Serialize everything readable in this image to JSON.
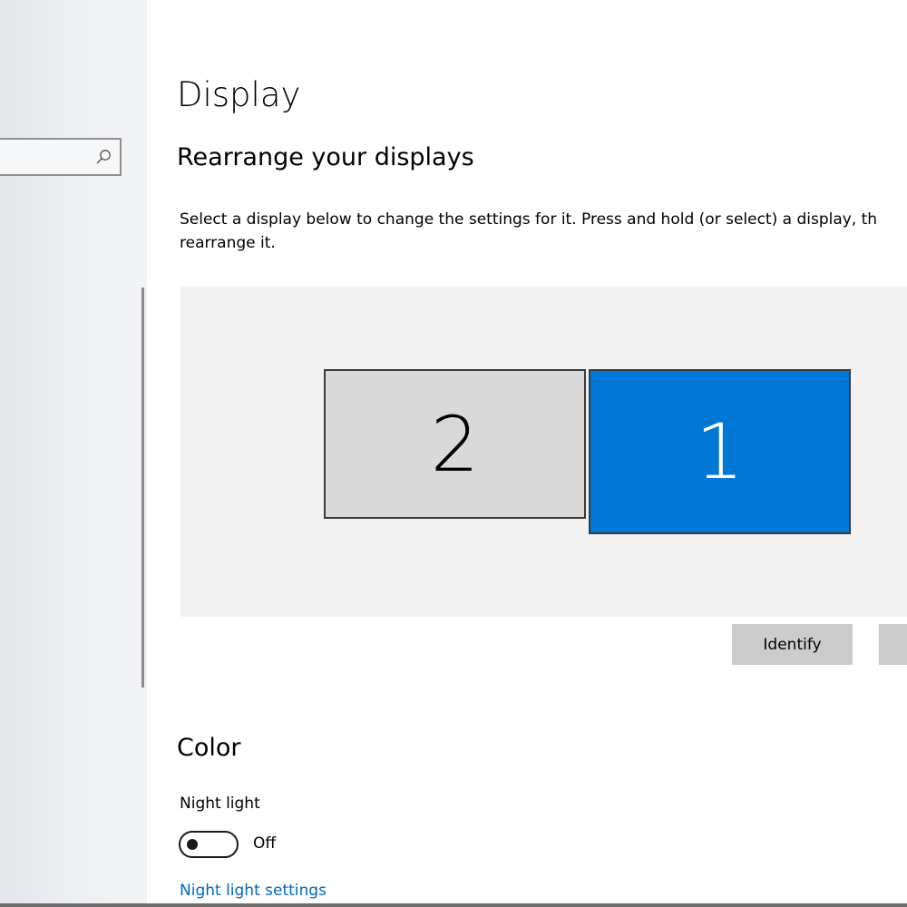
{
  "search": {
    "placeholder": "",
    "icon": "search-icon"
  },
  "page": {
    "title": "Display"
  },
  "rearrange": {
    "title": "Rearrange your displays",
    "description": "Select a display below to change the settings for it. Press and hold (or select) a display, th",
    "description_line2": "rearrange it.",
    "monitors": [
      {
        "label": "2",
        "selected": false
      },
      {
        "label": "1",
        "selected": true
      }
    ],
    "identify_label": "Identify",
    "detect_label": ""
  },
  "color": {
    "title": "Color",
    "night_light": {
      "label": "Night light",
      "state": "Off",
      "enabled": false
    },
    "settings_link": "Night light settings"
  },
  "colors": {
    "accent": "#0078d7",
    "link": "#0067c0",
    "unselected_monitor": "#d9d9d9",
    "arrange_background": "#f2f2f2",
    "button": "#cccccc"
  }
}
